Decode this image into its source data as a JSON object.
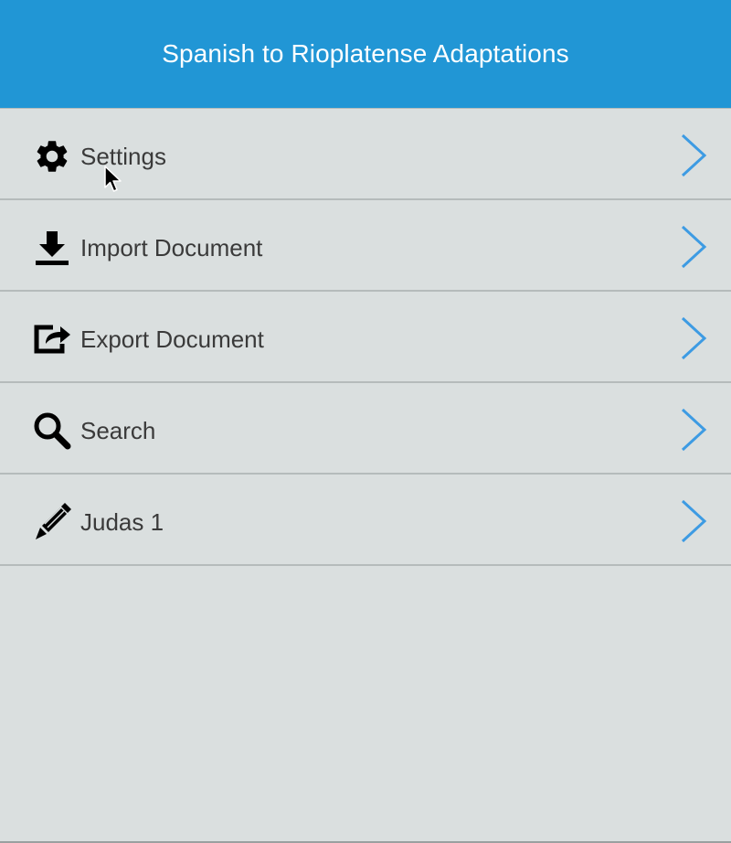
{
  "header": {
    "title": "Spanish to Rioplatense Adaptations"
  },
  "menu": {
    "items": [
      {
        "label": "Settings",
        "icon": "gear-icon"
      },
      {
        "label": "Import Document",
        "icon": "download-icon"
      },
      {
        "label": "Export Document",
        "icon": "share-icon"
      },
      {
        "label": "Search",
        "icon": "search-icon"
      },
      {
        "label": "Judas 1",
        "icon": "pencil-icon"
      }
    ]
  },
  "colors": {
    "header_bg": "#2196d5",
    "page_bg": "#dadfdf",
    "chevron": "#3d9be3",
    "text": "#3a3a3a"
  }
}
